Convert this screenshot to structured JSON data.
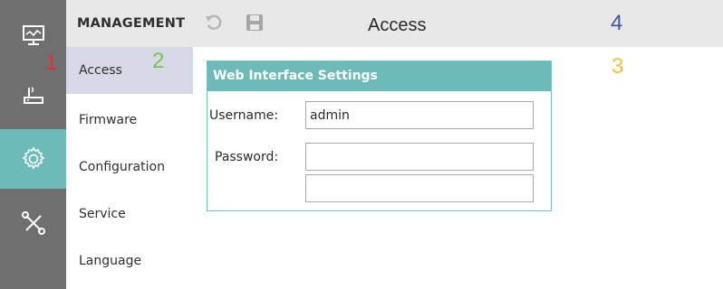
{
  "annotations": {
    "n1": "1",
    "n2": "2",
    "n3": "3",
    "n4": "4"
  },
  "colors": {
    "rail": "#6f6f6f",
    "accent": "#6cbbb8",
    "submenu_active": "#d7d9e7",
    "topbar": "#e8e8e8",
    "anno1": "#e0302b",
    "anno2": "#7bc44a",
    "anno3": "#f2c23a",
    "anno4": "#3b5a9a"
  },
  "rail": {
    "items": [
      {
        "icon": "monitor-icon"
      },
      {
        "icon": "router-icon"
      },
      {
        "icon": "gear-icon",
        "active": true
      },
      {
        "icon": "tools-icon"
      }
    ]
  },
  "submenu": {
    "title": "MANAGEMENT",
    "items": [
      {
        "label": "Access",
        "active": true
      },
      {
        "label": "Firmware"
      },
      {
        "label": "Configuration"
      },
      {
        "label": "Service"
      },
      {
        "label": "Language"
      }
    ]
  },
  "toolbar": {
    "undo_icon": "undo-icon",
    "save_icon": "save-icon",
    "title": "Access"
  },
  "panel": {
    "title": "Web Interface Settings",
    "username_label": "Username:",
    "username_value": "admin",
    "password_label": "Password:",
    "password_value": "",
    "confirm_value": ""
  }
}
